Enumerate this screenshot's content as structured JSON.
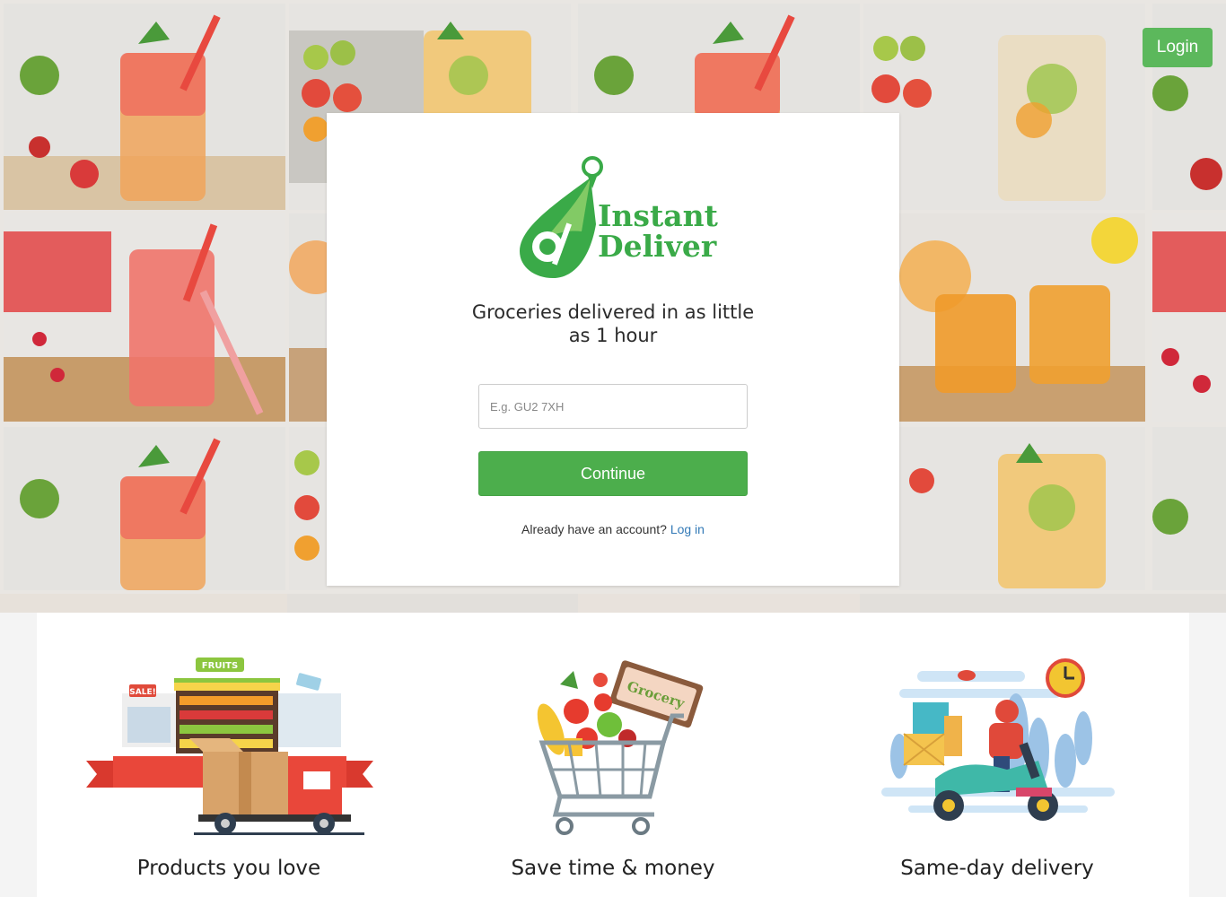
{
  "header": {
    "login_label": "Login"
  },
  "brand": {
    "line1": "Instant",
    "line2": "Deliver",
    "color": "#3aaa48"
  },
  "card": {
    "tagline_line1": "Groceries delivered in as little",
    "tagline_line2": "as 1 hour",
    "postcode_placeholder": "E.g. GU2 7XH",
    "continue_label": "Continue",
    "account_prompt": "Already have an account?",
    "login_link": "Log in"
  },
  "features": [
    {
      "title": "Products you love",
      "icon": "grocery-store-truck-illustration",
      "sign_text": "FRUITS",
      "sale_text": "SALE!"
    },
    {
      "title": "Save time & money",
      "icon": "grocery-cart-illustration",
      "sign_text": "Grocery"
    },
    {
      "title": "Same-day delivery",
      "icon": "scooter-delivery-illustration"
    }
  ],
  "colors": {
    "accent_green": "#5cb85c",
    "link_blue": "#337ab7"
  }
}
